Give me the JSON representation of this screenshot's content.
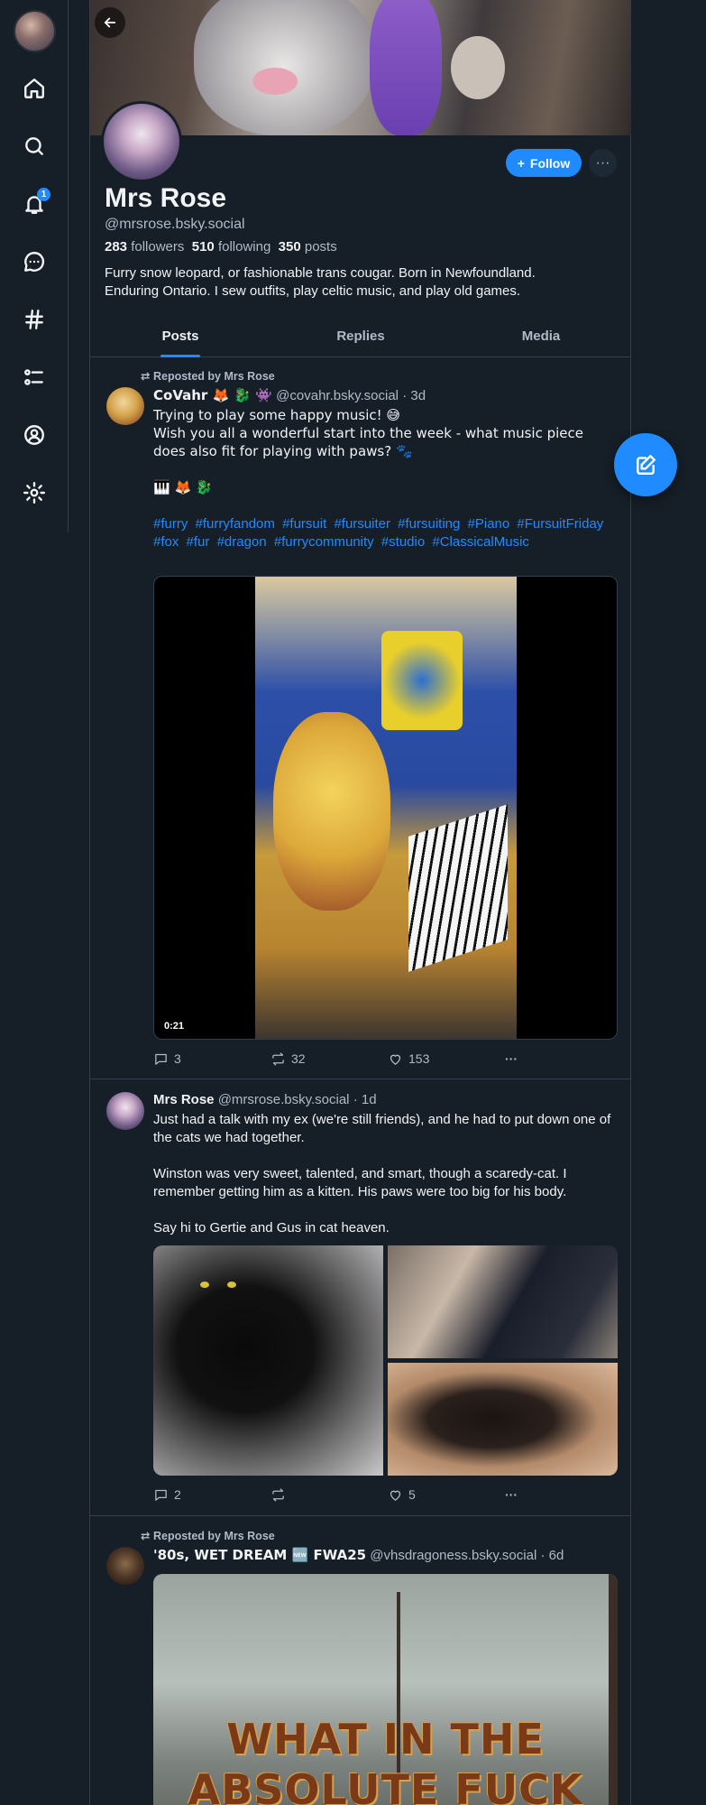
{
  "nav": {
    "notifications_badge": "1",
    "items": [
      "home",
      "search",
      "notifications",
      "chat",
      "feeds",
      "lists",
      "profile",
      "settings"
    ]
  },
  "profile": {
    "display_name": "Mrs Rose",
    "handle": "@mrsrose.bsky.social",
    "followers_count": "283",
    "followers_label": "followers",
    "following_count": "510",
    "following_label": "following",
    "posts_count": "350",
    "posts_label": "posts",
    "bio": "Furry snow leopard, or fashionable trans cougar. Born in Newfoundland.\nEnduring Ontario. I sew outfits, play celtic music, and play old games.",
    "follow_label": "Follow",
    "more_label": "···"
  },
  "tabs": [
    "Posts",
    "Replies",
    "Media"
  ],
  "posts": [
    {
      "repost_label": "Reposted by Mrs Rose",
      "author": "CoVahr 🦊 🐉 👾",
      "handle": "@covahr.bsky.social",
      "time": "· 3d",
      "text": "Trying to play some happy music! 😅\nWish you all a wonderful start into the week - what music piece does also fit for playing with paws? 🐾\n\n🎹 🦊 🐉",
      "hashtags": [
        "#furry",
        "#furryfandom",
        "#fursuit",
        "#fursuiter",
        "#fursuiting",
        "#Piano",
        "#FursuitFriday",
        "#fox",
        "#fur",
        "#dragon",
        "#furrycommunity",
        "#studio",
        "#ClassicalMusic"
      ],
      "video_time": "0:21",
      "replies": "3",
      "reposts": "32",
      "likes": "153"
    },
    {
      "author": "Mrs Rose",
      "handle": "@mrsrose.bsky.social",
      "time": "· 1d",
      "text": "Just had a talk with my ex (we're still friends), and he had to put down one of the cats we had together.\n\nWinston was very sweet, talented, and smart, though a scaredy-cat. I remember getting him as a kitten. His paws were too big for his body.\n\nSay hi to Gertie and Gus in cat heaven.",
      "replies": "2",
      "reposts": "",
      "likes": "5"
    },
    {
      "repost_label": "Reposted by Mrs Rose",
      "author": "'80s, WET DREAM 🆕 FWA25",
      "handle": "@vhsdragoness.bsky.social",
      "time": "· 6d",
      "gif_text": "WHAT IN THE ABSOLUTE FUCK"
    }
  ],
  "more_dots": "···"
}
